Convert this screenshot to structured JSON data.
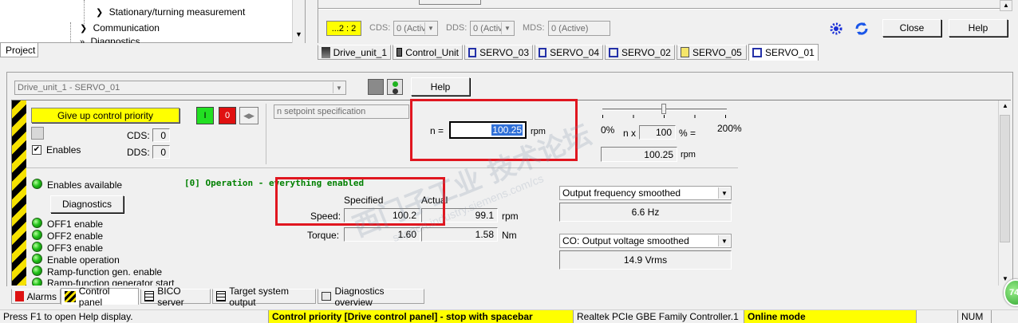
{
  "tree": {
    "items": [
      {
        "label": "Stationary/turning measurement"
      },
      {
        "label": "Communication"
      },
      {
        "label": "Diagnostics"
      }
    ],
    "project_tab": "Project"
  },
  "toolbar": {
    "ddc_value": "...2 : 2",
    "cds_label": "CDS:",
    "cds_value": "0 (Activ",
    "dds_label": "DDS:",
    "dds_value": "0 (Activ",
    "mds_label": "MDS:",
    "mds_value": "0 (Active)",
    "close_label": "Close",
    "help_label": "Help"
  },
  "workbook_tabs": [
    {
      "label": "Drive_unit_1"
    },
    {
      "label": "Control_Unit"
    },
    {
      "label": "SERVO_03"
    },
    {
      "label": "SERVO_04"
    },
    {
      "label": "SERVO_02"
    },
    {
      "label": "SERVO_05"
    },
    {
      "label": "SERVO_01"
    }
  ],
  "panel": {
    "drive_select": "Drive_unit_1 - SERVO_01",
    "help_label": "Help",
    "give_up_label": "Give up control priority",
    "on_label": "I",
    "off_label": "0",
    "cds_label": "CDS:",
    "cds_value": "0",
    "dds_label": "DDS:",
    "dds_value": "0",
    "enables_label": "Enables",
    "setpoint_spec": "n setpoint specification",
    "n_label": "n =",
    "n_value": "100.25",
    "n_unit": "rpm",
    "slider_min": "0%",
    "slider_max": "200%",
    "n_x_label": "n x",
    "percent_value": "100",
    "percent_eq": "% =",
    "result_value": "100.25",
    "result_unit": "rpm",
    "enables_available": "Enables available",
    "diagnostics_label": "Diagnostics",
    "operation_status": "[0] Operation - everything enabled",
    "specified_label": "Specified",
    "actual_label": "Actual",
    "speed_label": "Speed:",
    "speed_specified": "100.2",
    "speed_actual": "99.1",
    "speed_unit": "rpm",
    "torque_label": "Torque:",
    "torque_specified": "1.60",
    "torque_actual": "1.58",
    "torque_unit": "Nm",
    "enable_list": [
      "OFF1 enable",
      "OFF2 enable",
      "OFF3 enable",
      "Enable operation",
      "Ramp-function gen. enable",
      "Ramp-function generator start"
    ],
    "monitor1_select": "Output frequency smoothed",
    "monitor1_value": "6.6 Hz",
    "monitor2_select": "CO: Output voltage smoothed",
    "monitor2_value": "14.9 Vrms"
  },
  "bottom_tabs": [
    {
      "label": "Alarms"
    },
    {
      "label": "Control panel"
    },
    {
      "label": "BICO server"
    },
    {
      "label": "Target system output"
    },
    {
      "label": "Diagnostics overview"
    }
  ],
  "statusbar": {
    "help_hint": "Press F1 to open Help display.",
    "priority_msg": "Control priority [Drive control panel] - stop with spacebar",
    "adapter": "Realtek PCIe GBE Family Controller.1",
    "mode": "Online mode",
    "num": "NUM"
  },
  "badge": {
    "value": "74"
  },
  "watermark": {
    "text1": "西门子工业 技术论坛",
    "text2": "support.industry.siemens.com/cs"
  },
  "colors": {
    "highlight_yellow": "#ffff00",
    "red_frame": "#e0161f",
    "led_green": "#22c21a",
    "status_green_text": "#008000"
  }
}
